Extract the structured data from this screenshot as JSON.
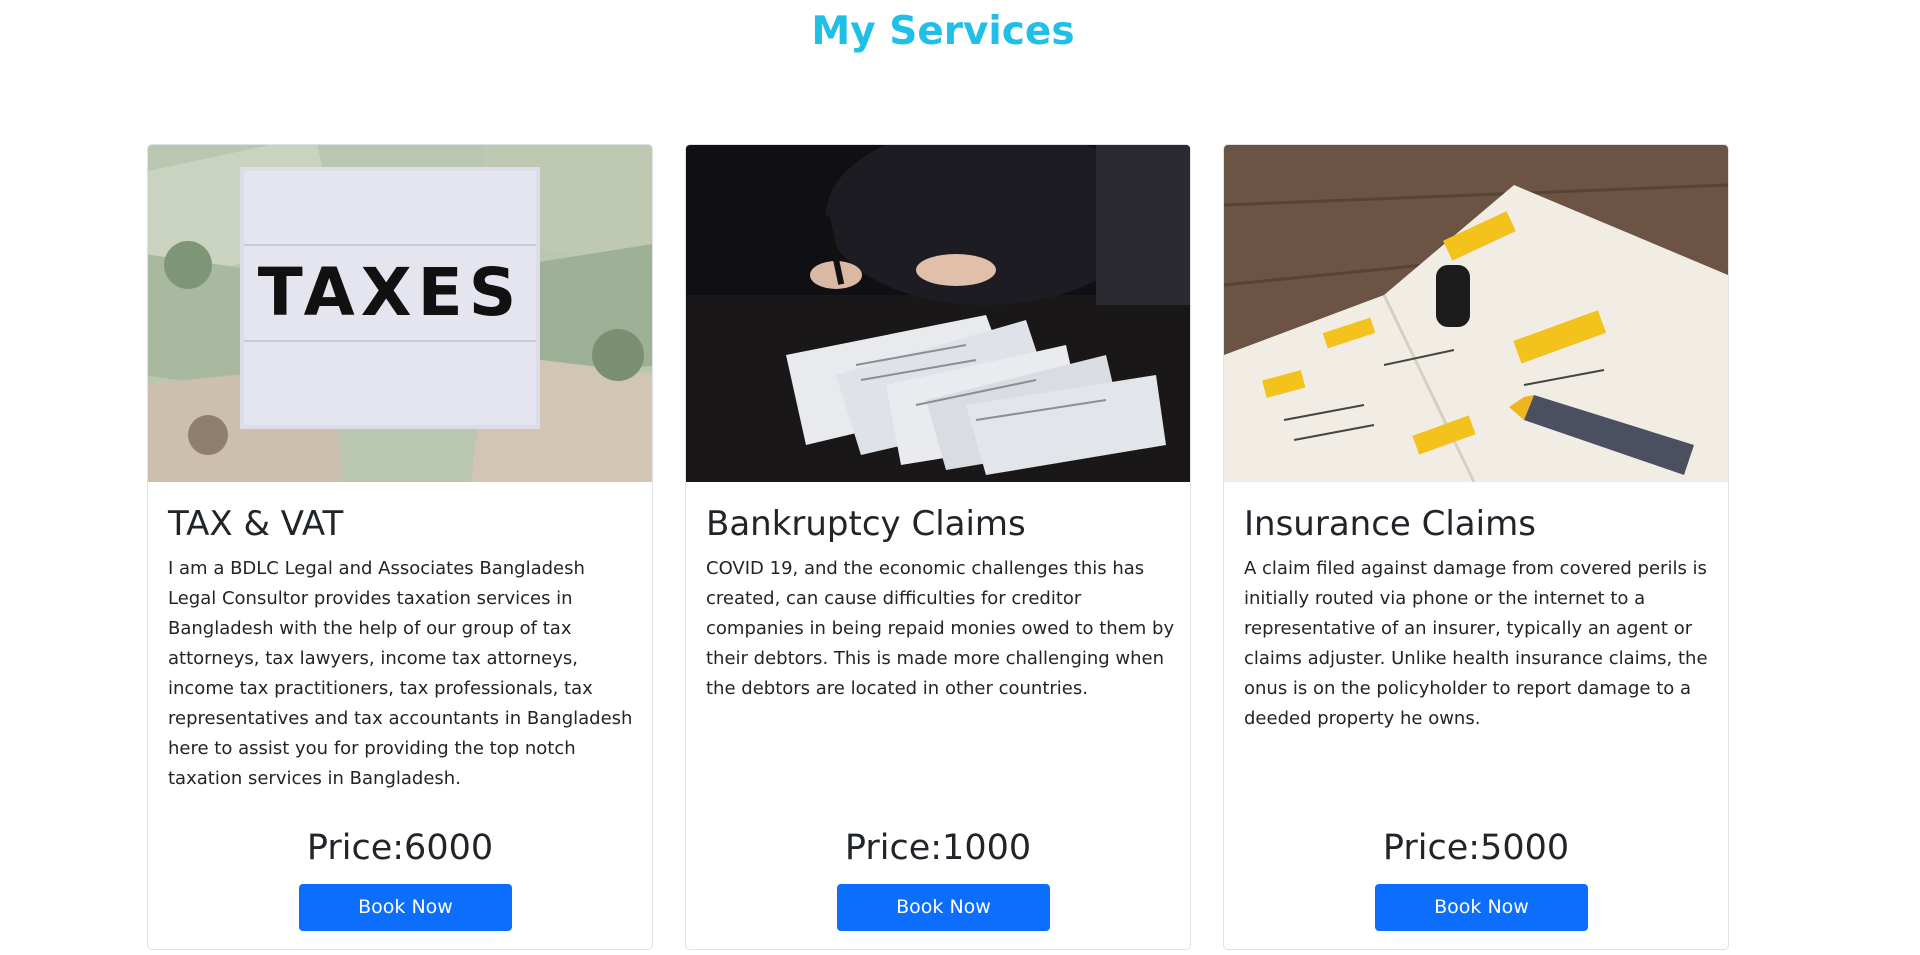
{
  "page": {
    "title": "My Services"
  },
  "colors": {
    "title": "#1fbfe8",
    "button": "#0d6efd",
    "button_text": "#ffffff"
  },
  "services": [
    {
      "title": "TAX & VAT",
      "image_icon": "taxes-lightbox-photo",
      "image_text": "TAXES",
      "description": "I am a BDLC Legal and Associates Bangladesh Legal Consultor provides taxation services in Bangladesh with the help of our group of tax attorneys, tax lawyers, income tax attorneys, income tax practitioners, tax professionals, tax representatives and tax accountants in Bangladesh here to assist you for providing the top notch taxation services in Bangladesh.",
      "price": "Price:6000",
      "button_label": "Book Now"
    },
    {
      "title": "Bankruptcy Claims",
      "image_icon": "signing-documents-photo",
      "description": "COVID 19, and the economic challenges this has created, can cause difficulties for creditor companies in being repaid monies owed to them by their debtors. This is made more challenging when the debtors are located in other countries.",
      "price": "Price:1000",
      "button_label": "Book Now"
    },
    {
      "title": "Insurance Claims",
      "image_icon": "planner-notebook-photo",
      "description": "A claim filed against damage from covered perils is initially routed via phone or the internet to a representative of an insurer, typically an agent or claims adjuster. Unlike health insurance claims, the onus is on the policyholder to report damage to a deeded property he owns.",
      "price": "Price:5000",
      "button_label": "Book Now"
    }
  ]
}
